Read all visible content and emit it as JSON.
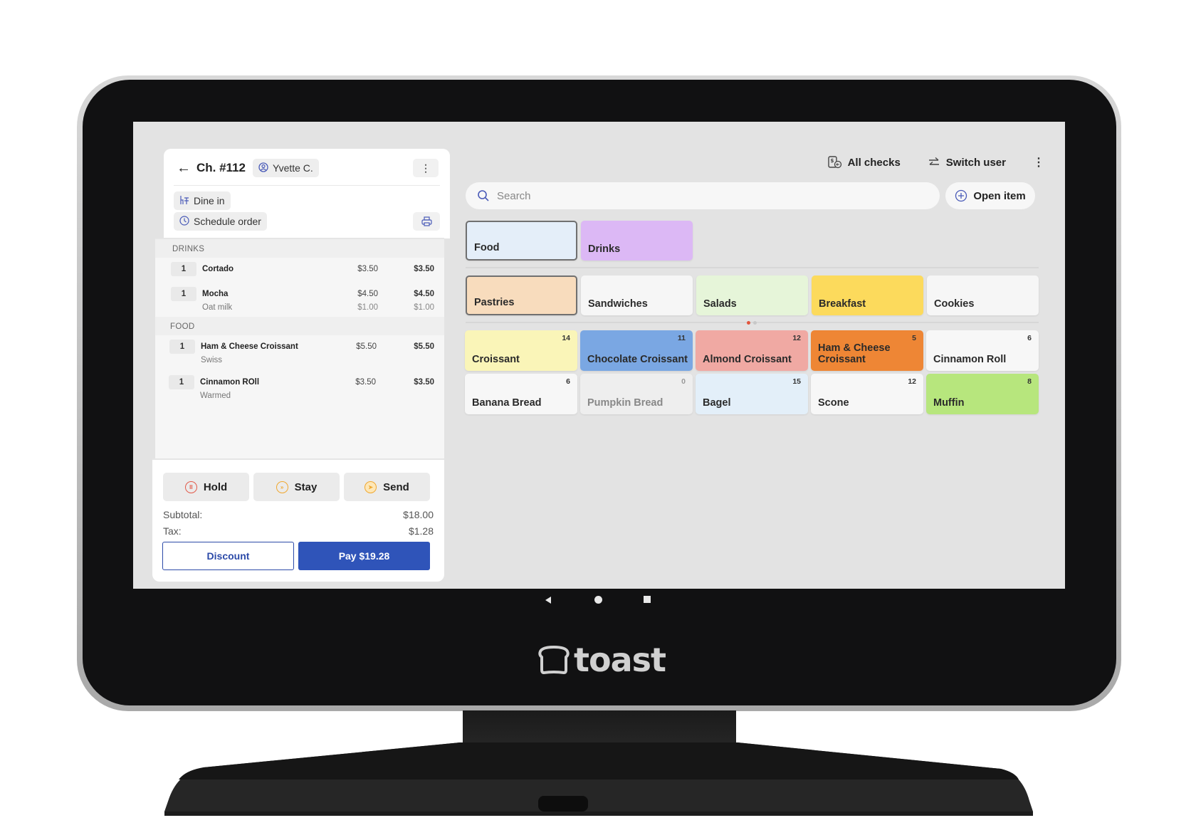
{
  "check": {
    "back_label": "←",
    "title": "Ch. #112",
    "server": "Yvette C.",
    "dining_option": "Dine in",
    "schedule_label": "Schedule order",
    "sections": [
      {
        "label": "DRINKS",
        "items": [
          {
            "qty": "1",
            "name": "Cortado",
            "price": "$3.50",
            "total": "$3.50"
          },
          {
            "qty": "1",
            "name": "Mocha",
            "price": "$4.50",
            "total": "$4.50",
            "modifier": "Oat milk",
            "modifier_price": "$1.00",
            "modifier_total": "$1.00"
          }
        ]
      },
      {
        "label": "FOOD",
        "items": [
          {
            "qty": "1",
            "name": "Ham & Cheese Croissant",
            "price": "$5.50",
            "total": "$5.50",
            "modifier": "Swiss"
          },
          {
            "qty": "1",
            "name": "Cinnamon ROll",
            "price": "$3.50",
            "total": "$3.50",
            "modifier": "Warmed"
          }
        ]
      }
    ],
    "actions": {
      "hold": "Hold",
      "stay": "Stay",
      "send": "Send"
    },
    "subtotal_label": "Subtotal:",
    "subtotal": "$18.00",
    "tax_label": "Tax:",
    "tax": "$1.28",
    "discount_label": "Discount",
    "pay_label": "Pay $19.28"
  },
  "topbar": {
    "all_checks": "All checks",
    "switch_user": "Switch user"
  },
  "search": {
    "placeholder": "Search",
    "value": ""
  },
  "open_item_label": "Open item",
  "menus": [
    {
      "label": "Food",
      "color": "#e4eef9",
      "selected": true
    },
    {
      "label": "Drinks",
      "color": "#dcb8f5",
      "selected": false
    }
  ],
  "groups": [
    {
      "label": "Pastries",
      "color": "#f8dcbd",
      "selected": true
    },
    {
      "label": "Sandwiches",
      "color": "#f6f6f6",
      "selected": false
    },
    {
      "label": "Salads",
      "color": "#e6f5d9",
      "selected": false
    },
    {
      "label": "Breakfast",
      "color": "#fcda5c",
      "selected": false
    },
    {
      "label": "Cookies",
      "color": "#f6f6f6",
      "selected": false
    }
  ],
  "items": [
    {
      "label": "Croissant",
      "count": "14",
      "color": "#faf5b8"
    },
    {
      "label": "Chocolate Croissant",
      "count": "11",
      "color": "#7aa7e3"
    },
    {
      "label": "Almond Croissant",
      "count": "12",
      "color": "#f0a9a3"
    },
    {
      "label": "Ham & Cheese Croissant",
      "count": "5",
      "color": "#ee8635"
    },
    {
      "label": "Cinnamon Roll",
      "count": "6",
      "color": "#f7f7f7"
    },
    {
      "label": "Banana Bread",
      "count": "6",
      "color": "#f7f7f7"
    },
    {
      "label": "Pumpkin Bread",
      "count": "0",
      "color": "#eeeeee",
      "disabled": true
    },
    {
      "label": "Bagel",
      "count": "15",
      "color": "#e3eff9"
    },
    {
      "label": "Scone",
      "count": "12",
      "color": "#f7f7f7"
    },
    {
      "label": "Muffin",
      "count": "8",
      "color": "#b7e67d"
    }
  ],
  "pagination": {
    "current": 1,
    "total": 2
  },
  "brand": "toast"
}
